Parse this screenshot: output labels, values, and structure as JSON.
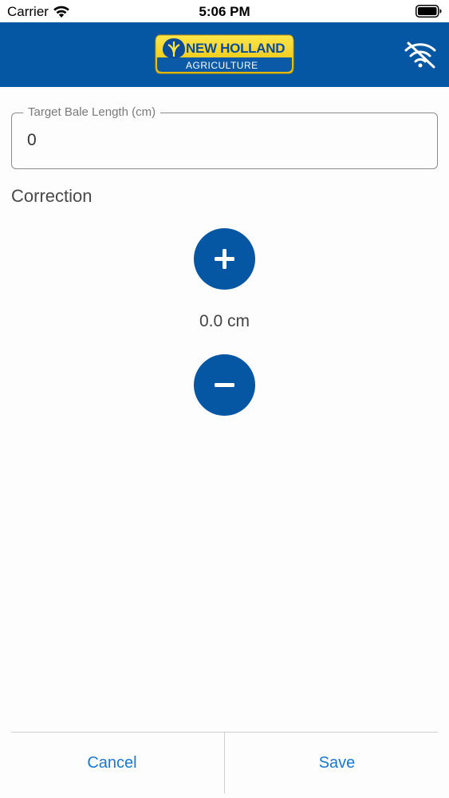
{
  "status_bar": {
    "carrier": "Carrier",
    "time": "5:06 PM",
    "icons": [
      "wifi-icon",
      "battery-icon"
    ]
  },
  "header": {
    "logo_line1": "NEW HOLLAND",
    "logo_line2": "AGRICULTURE",
    "background_color": "#0556a3",
    "logo_color": "#f6d20a",
    "status_icon": "wifi-off-icon"
  },
  "target_field": {
    "label": "Target Bale Length (cm)",
    "value": "0"
  },
  "correction": {
    "title": "Correction",
    "value": "0.0 cm",
    "increase_icon": "plus-icon",
    "decrease_icon": "minus-icon"
  },
  "footer": {
    "cancel_label": "Cancel",
    "save_label": "Save",
    "accent_color": "#1a78d2"
  }
}
